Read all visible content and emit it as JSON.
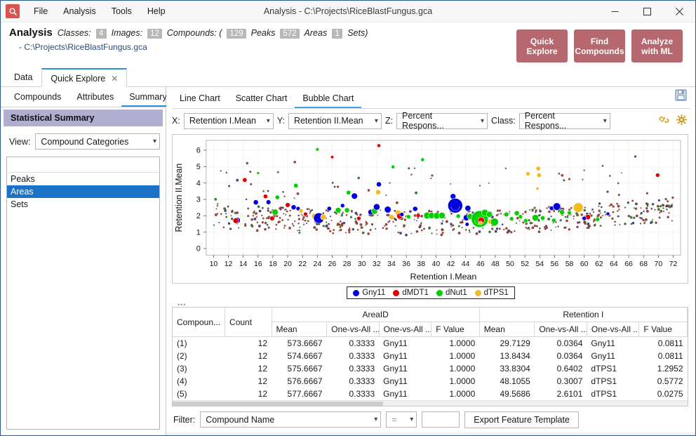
{
  "window": {
    "title": "Analysis - C:\\Projects\\RiceBlastFungus.gca",
    "app_icon": "magnifier-icon",
    "minimize": "—",
    "maximize": "☐",
    "close": "✕"
  },
  "menubar": {
    "items": [
      "File",
      "Analysis",
      "Tools",
      "Help"
    ]
  },
  "header": {
    "app_name": "Analysis",
    "classes_label": "Classes:",
    "classes_value": "4",
    "images_label": "Images:",
    "images_value": "12",
    "compounds_label": "Compounds: (",
    "compounds_value": "129",
    "peaks_label": "Peaks",
    "peaks_value": "572",
    "areas_label": "Areas",
    "areas_value": "1",
    "sets_label": "Sets)",
    "path": "- C:\\Projects\\RiceBlastFungus.gca",
    "buttons": [
      {
        "label": "Quick\nExplore",
        "line1": "Quick",
        "line2": "Explore"
      },
      {
        "label": "Find Compounds",
        "line1": "Find",
        "line2": "Compounds"
      },
      {
        "label": "Analyze with ML",
        "line1": "Analyze",
        "line2": "with ML"
      }
    ],
    "accent_color": "#b5696e"
  },
  "outer_tabs": [
    {
      "label": "Data",
      "active": false
    },
    {
      "label": "Quick Explore",
      "active": true,
      "closable": true
    }
  ],
  "sidebar": {
    "tabs": [
      {
        "label": "Compounds",
        "active": false
      },
      {
        "label": "Attributes",
        "active": false
      },
      {
        "label": "Summary",
        "active": true
      }
    ],
    "section_title": "Statistical Summary",
    "section_bg": "#b0aed1",
    "view_label": "View:",
    "view_value": "Compound Categories",
    "list_items": [
      {
        "label": "Peaks",
        "selected": false
      },
      {
        "label": "Areas",
        "selected": true
      },
      {
        "label": "Sets",
        "selected": false
      }
    ],
    "selection_color": "#1a73c8"
  },
  "chart_panel": {
    "tabs": [
      {
        "label": "Line Chart",
        "active": false
      },
      {
        "label": "Scatter Chart",
        "active": false
      },
      {
        "label": "Bubble Chart",
        "active": true
      }
    ],
    "save_icon": "save-floppy-icon",
    "link_icon": "link-chain-icon",
    "settings_icon": "gear-icon",
    "axis_selectors": [
      {
        "label": "X:",
        "value": "Retention I.Mean",
        "name": "x-axis-select"
      },
      {
        "label": "Y:",
        "value": "Retention II.Mean",
        "name": "y-axis-select"
      },
      {
        "label": "Z:",
        "value": "Percent Respons...",
        "name": "z-axis-select"
      },
      {
        "label": "Class:",
        "value": "Percent Respons...",
        "name": "class-select"
      }
    ]
  },
  "chart_data": {
    "type": "scatter",
    "title": "",
    "xlabel": "Retention I.Mean",
    "ylabel": "Retention II.Mean",
    "xlim": [
      9,
      73
    ],
    "ylim": [
      -0.4,
      6.6
    ],
    "xticks": [
      10,
      12,
      14,
      16,
      18,
      20,
      22,
      24,
      26,
      28,
      30,
      32,
      34,
      36,
      38,
      40,
      42,
      44,
      46,
      48,
      50,
      52,
      54,
      56,
      58,
      60,
      62,
      64,
      66,
      68,
      70,
      72
    ],
    "yticks": [
      0,
      1,
      2,
      3,
      4,
      5,
      6
    ],
    "grid": true,
    "legend_position": "bottom-center",
    "series": [
      {
        "name": "Gny11",
        "color": "#0000e0"
      },
      {
        "name": "dMDT1",
        "color": "#e00000"
      },
      {
        "name": "dNut1",
        "color": "#00d000"
      },
      {
        "name": "dTPS1",
        "color": "#f0bc20"
      }
    ],
    "bubbles": [
      {
        "x": 13.2,
        "y": 1.72,
        "r": 4.2,
        "c": 0
      },
      {
        "x": 13.0,
        "y": 1.7,
        "r": 4.0,
        "c": 1
      },
      {
        "x": 14.2,
        "y": 4.18,
        "r": 3.2,
        "c": 1
      },
      {
        "x": 15.7,
        "y": 2.82,
        "r": 3.6,
        "c": 0
      },
      {
        "x": 17.0,
        "y": 3.18,
        "r": 3.2,
        "c": 1
      },
      {
        "x": 17.4,
        "y": 2.83,
        "r": 3.4,
        "c": 0
      },
      {
        "x": 17.9,
        "y": 1.84,
        "r": 3.4,
        "c": 1
      },
      {
        "x": 18.3,
        "y": 2.22,
        "r": 4.4,
        "c": 2
      },
      {
        "x": 18.6,
        "y": 3.12,
        "r": 3.2,
        "c": 2
      },
      {
        "x": 16.0,
        "y": 4.6,
        "r": 2.0,
        "c": 2
      },
      {
        "x": 20.0,
        "y": 2.66,
        "r": 3.4,
        "c": 1
      },
      {
        "x": 20.8,
        "y": 2.52,
        "r": 3.6,
        "c": 0
      },
      {
        "x": 21.1,
        "y": 3.84,
        "r": 3.2,
        "c": 2
      },
      {
        "x": 21.4,
        "y": 2.44,
        "r": 3.0,
        "c": 0
      },
      {
        "x": 21.8,
        "y": 2.3,
        "r": 3.0,
        "c": 3
      },
      {
        "x": 22.4,
        "y": 2.1,
        "r": 3.0,
        "c": 1
      },
      {
        "x": 23.6,
        "y": 1.98,
        "r": 4.0,
        "c": 3
      },
      {
        "x": 24.2,
        "y": 1.86,
        "r": 7.5,
        "c": 0
      },
      {
        "x": 24.8,
        "y": 1.92,
        "r": 4.0,
        "c": 3
      },
      {
        "x": 25.6,
        "y": 2.44,
        "r": 3.2,
        "c": 0
      },
      {
        "x": 24.0,
        "y": 6.05,
        "r": 2.4,
        "c": 2
      },
      {
        "x": 26.0,
        "y": 5.58,
        "r": 2.2,
        "c": 1
      },
      {
        "x": 26.8,
        "y": 2.34,
        "r": 4.0,
        "c": 2
      },
      {
        "x": 27.4,
        "y": 2.62,
        "r": 3.0,
        "c": 0
      },
      {
        "x": 28.0,
        "y": 2.34,
        "r": 3.6,
        "c": 2
      },
      {
        "x": 28.2,
        "y": 3.42,
        "r": 3.2,
        "c": 2
      },
      {
        "x": 29.0,
        "y": 3.2,
        "r": 4.4,
        "c": 0
      },
      {
        "x": 29.6,
        "y": 1.84,
        "r": 3.0,
        "c": 1
      },
      {
        "x": 31.2,
        "y": 2.22,
        "r": 4.0,
        "c": 0
      },
      {
        "x": 31.7,
        "y": 2.28,
        "r": 4.4,
        "c": 2
      },
      {
        "x": 32.0,
        "y": 2.54,
        "r": 4.6,
        "c": 0
      },
      {
        "x": 32.3,
        "y": 3.92,
        "r": 3.6,
        "c": 0
      },
      {
        "x": 32.2,
        "y": 3.44,
        "r": 3.6,
        "c": 3
      },
      {
        "x": 32.3,
        "y": 6.28,
        "r": 2.6,
        "c": 1
      },
      {
        "x": 33.5,
        "y": 2.38,
        "r": 4.8,
        "c": 0
      },
      {
        "x": 34.0,
        "y": 1.92,
        "r": 3.6,
        "c": 3
      },
      {
        "x": 34.2,
        "y": 4.98,
        "r": 2.6,
        "c": 2
      },
      {
        "x": 34.9,
        "y": 2.18,
        "r": 4.0,
        "c": 3
      },
      {
        "x": 35.1,
        "y": 1.98,
        "r": 4.2,
        "c": 1
      },
      {
        "x": 35.4,
        "y": 2.08,
        "r": 3.0,
        "c": 0
      },
      {
        "x": 36.3,
        "y": 1.94,
        "r": 3.0,
        "c": 2
      },
      {
        "x": 37.2,
        "y": 2.42,
        "r": 3.6,
        "c": 0
      },
      {
        "x": 37.6,
        "y": 2.02,
        "r": 3.0,
        "c": 1
      },
      {
        "x": 38.2,
        "y": 5.42,
        "r": 2.6,
        "c": 2
      },
      {
        "x": 38.8,
        "y": 2.02,
        "r": 4.8,
        "c": 2
      },
      {
        "x": 39.4,
        "y": 2.02,
        "r": 4.4,
        "c": 2
      },
      {
        "x": 40.1,
        "y": 2.0,
        "r": 4.6,
        "c": 2
      },
      {
        "x": 40.8,
        "y": 2.02,
        "r": 4.6,
        "c": 2
      },
      {
        "x": 42.3,
        "y": 3.18,
        "r": 4.0,
        "c": 0
      },
      {
        "x": 42.6,
        "y": 2.62,
        "r": 10.5,
        "c": 0
      },
      {
        "x": 44.3,
        "y": 2.46,
        "r": 4.2,
        "c": 0
      },
      {
        "x": 44.1,
        "y": 1.88,
        "r": 4.4,
        "c": 0
      },
      {
        "x": 44.6,
        "y": 1.96,
        "r": 4.2,
        "c": 2
      },
      {
        "x": 45.9,
        "y": 1.8,
        "r": 12.0,
        "c": 2
      },
      {
        "x": 46.1,
        "y": 1.72,
        "r": 4.6,
        "c": 1
      },
      {
        "x": 46.6,
        "y": 2.18,
        "r": 5.0,
        "c": 2
      },
      {
        "x": 47.2,
        "y": 2.08,
        "r": 4.2,
        "c": 2
      },
      {
        "x": 47.4,
        "y": 1.64,
        "r": 4.0,
        "c": 3
      },
      {
        "x": 47.9,
        "y": 1.62,
        "r": 5.6,
        "c": 2
      },
      {
        "x": 44.2,
        "y": 1.48,
        "r": 2.8,
        "c": 0
      },
      {
        "x": 46.0,
        "y": 1.56,
        "r": 2.8,
        "c": 3
      },
      {
        "x": 49.5,
        "y": 2.08,
        "r": 3.4,
        "c": 2
      },
      {
        "x": 50.2,
        "y": 1.82,
        "r": 3.0,
        "c": 2
      },
      {
        "x": 50.9,
        "y": 2.16,
        "r": 3.6,
        "c": 2
      },
      {
        "x": 51.4,
        "y": 1.94,
        "r": 3.0,
        "c": 2
      },
      {
        "x": 52.1,
        "y": 1.7,
        "r": 3.0,
        "c": 2
      },
      {
        "x": 52.4,
        "y": 4.56,
        "r": 3.0,
        "c": 3
      },
      {
        "x": 53.8,
        "y": 4.88,
        "r": 3.2,
        "c": 3
      },
      {
        "x": 53.9,
        "y": 4.48,
        "r": 3.2,
        "c": 3
      },
      {
        "x": 53.7,
        "y": 3.66,
        "r": 2.2,
        "c": 3
      },
      {
        "x": 53.4,
        "y": 1.88,
        "r": 4.6,
        "c": 2
      },
      {
        "x": 54.4,
        "y": 1.86,
        "r": 3.2,
        "c": 2
      },
      {
        "x": 55.6,
        "y": 2.46,
        "r": 3.2,
        "c": 0
      },
      {
        "x": 56.3,
        "y": 2.56,
        "r": 5.4,
        "c": 0
      },
      {
        "x": 57.0,
        "y": 2.22,
        "r": 3.6,
        "c": 2
      },
      {
        "x": 55.9,
        "y": 1.72,
        "r": 3.0,
        "c": 2
      },
      {
        "x": 59.2,
        "y": 2.5,
        "r": 7.0,
        "c": 3
      },
      {
        "x": 60.5,
        "y": 1.92,
        "r": 3.8,
        "c": 1
      },
      {
        "x": 60.0,
        "y": 1.84,
        "r": 3.0,
        "c": 0
      },
      {
        "x": 61.8,
        "y": 1.78,
        "r": 3.0,
        "c": 2
      },
      {
        "x": 63.2,
        "y": 2.12,
        "r": 2.6,
        "c": 0
      },
      {
        "x": 69.9,
        "y": 4.48,
        "r": 3.0,
        "c": 1
      },
      {
        "x": 58.0,
        "y": 2.18,
        "r": 3.0,
        "c": 2
      },
      {
        "x": 43.0,
        "y": 1.98,
        "r": 3.0,
        "c": 2
      }
    ],
    "small_point_color": "#8a3b2e",
    "note": "Dense cloud of small dark points (~572 peaks) plus colored class bubbles sized by percent response."
  },
  "table": {
    "group_headers": [
      "",
      "",
      "AreaID",
      "Retention I"
    ],
    "columns": [
      "Compoun...",
      "Count",
      "Mean",
      "One-vs-All ...",
      "One-vs-All ...",
      "F Value",
      "Mean",
      "One-vs-All ...",
      "One-vs-All ...",
      "F Value"
    ],
    "rows": [
      [
        "(1)",
        "12",
        "573.6667",
        "0.3333",
        "Gny11",
        "1.0000",
        "29.7129",
        "0.0364",
        "Gny11",
        "0.0811"
      ],
      [
        "(2)",
        "12",
        "574.6667",
        "0.3333",
        "Gny11",
        "1.0000",
        "13.8434",
        "0.0364",
        "Gny11",
        "0.0811"
      ],
      [
        "(3)",
        "12",
        "575.6667",
        "0.3333",
        "Gny11",
        "1.0000",
        "33.8304",
        "0.6402",
        "dTPS1",
        "1.2952"
      ],
      [
        "(4)",
        "12",
        "576.6667",
        "0.3333",
        "Gny11",
        "1.0000",
        "48.1055",
        "0.3007",
        "dTPS1",
        "0.5772"
      ],
      [
        "(5)",
        "12",
        "577.6667",
        "0.3333",
        "Gny11",
        "1.0000",
        "49.5686",
        "2.6101",
        "dTPS1",
        "0.0275"
      ]
    ]
  },
  "filter": {
    "label": "Filter:",
    "field_value": "Compound Name",
    "operator_value": "=",
    "value_text": "",
    "export_button": "Export Feature Template"
  }
}
